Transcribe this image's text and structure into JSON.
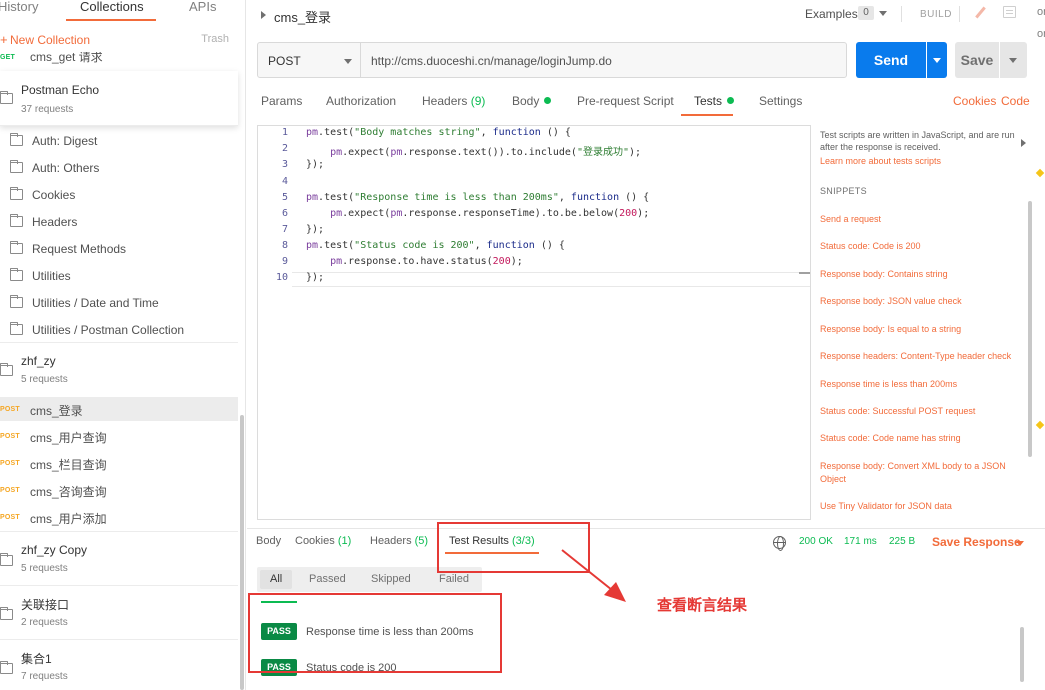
{
  "sidebar": {
    "tabs": [
      "History",
      "Collections",
      "APIs"
    ],
    "new_collection": "New Collection",
    "trash": "Trash",
    "top_request": {
      "method": "GET",
      "name": "cms_get 请求"
    },
    "collections": [
      {
        "name": "Postman Echo",
        "count": "37 requests"
      },
      {
        "name": "zhf_zy",
        "count": "5 requests"
      },
      {
        "name": "zhf_zy Copy",
        "count": "5 requests"
      },
      {
        "name": "关联接口",
        "count": "2 requests"
      },
      {
        "name": "集合1",
        "count": "7 requests"
      }
    ],
    "folders": [
      "Auth: Digest",
      "Auth: Others",
      "Cookies",
      "Headers",
      "Request Methods",
      "Utilities",
      "Utilities / Date and Time",
      "Utilities / Postman Collection"
    ],
    "requests": [
      {
        "method": "POST",
        "name": "cms_登录"
      },
      {
        "method": "POST",
        "name": "cms_用户查询"
      },
      {
        "method": "POST",
        "name": "cms_栏目查询"
      },
      {
        "method": "POST",
        "name": "cms_咨询查询"
      },
      {
        "method": "POST",
        "name": "cms_用户添加"
      }
    ]
  },
  "header": {
    "title": "cms_登录",
    "examples_label": "Examples",
    "examples_count": "0",
    "build_label": "BUILD"
  },
  "request": {
    "method": "POST",
    "url": "http://cms.duoceshi.cn/manage/loginJump.do",
    "send_label": "Send",
    "save_label": "Save"
  },
  "req_tabs": {
    "params": "Params",
    "authorization": "Authorization",
    "headers": "Headers",
    "headers_count": "(9)",
    "body": "Body",
    "prerequest": "Pre-request Script",
    "tests": "Tests",
    "settings": "Settings",
    "cookies": "Cookies",
    "code": "Code"
  },
  "editor": {
    "line_numbers": [
      "1",
      "2",
      "3",
      "4",
      "5",
      "6",
      "7",
      "8",
      "9",
      "10"
    ]
  },
  "snippets": {
    "description": "Test scripts are written in JavaScript, and are run after the response is received.",
    "learn_more": "Learn more about tests scripts",
    "heading": "SNIPPETS",
    "items": [
      "Send a request",
      "Status code: Code is 200",
      "Response body: Contains string",
      "Response body: JSON value check",
      "Response body: Is equal to a string",
      "Response headers: Content-Type header check",
      "Response time is less than 200ms",
      "Status code: Successful POST request",
      "Status code: Code name has string",
      "Response body: Convert XML body to a JSON Object",
      "Use Tiny Validator for JSON data"
    ]
  },
  "response": {
    "tabs": {
      "body": "Body",
      "cookies": "Cookies",
      "cookies_count": "(1)",
      "headers": "Headers",
      "headers_count": "(5)",
      "test_results": "Test Results",
      "test_results_count": "(3/3)"
    },
    "status": "200 OK",
    "time": "171 ms",
    "size": "225 B",
    "save_response": "Save Response",
    "filters": [
      "All",
      "Passed",
      "Skipped",
      "Failed"
    ],
    "results": [
      {
        "status": "PASS",
        "name": "Response time is less than 200ms"
      },
      {
        "status": "PASS",
        "name": "Status code is 200"
      }
    ]
  },
  "annotation": {
    "text": "查看断言结果"
  },
  "colors": {
    "accent": "#f26b3a",
    "send_blue": "#097bed",
    "pass_green": "#0a8a45",
    "annotation_red": "#e53935"
  }
}
